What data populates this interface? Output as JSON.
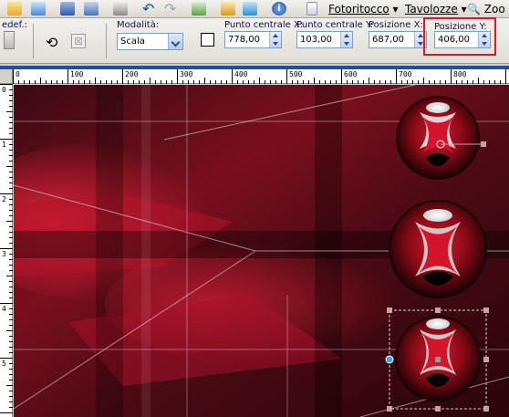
{
  "menubar": {
    "left_text": "edef.:",
    "fotoritocco": "Fotoritocco",
    "tavolozze": "Tavolozze",
    "zoom": "Zoo"
  },
  "options": {
    "modalita_label": "Modalità:",
    "modalita_value": "Scala",
    "punto_x_label": "Punto centrale X:",
    "punto_x_value": "778,00",
    "punto_y_label": "Punto centrale Y:",
    "punto_y_value": "103,00",
    "pos_x_label": "Posizione X:",
    "pos_x_value": "687,00",
    "pos_y_label": "Posizione Y:",
    "pos_y_value": "406,00"
  },
  "ruler": {
    "h_ticks": [
      "0",
      "100",
      "200",
      "300",
      "400",
      "500",
      "600",
      "700",
      "800"
    ],
    "v_ticks": [
      "0",
      "1",
      "2",
      "3",
      "4",
      "5"
    ]
  },
  "colors": {
    "highlight": "#d7192a",
    "canvas_base": "#5a0d18",
    "accent_red": "#c7142a"
  }
}
